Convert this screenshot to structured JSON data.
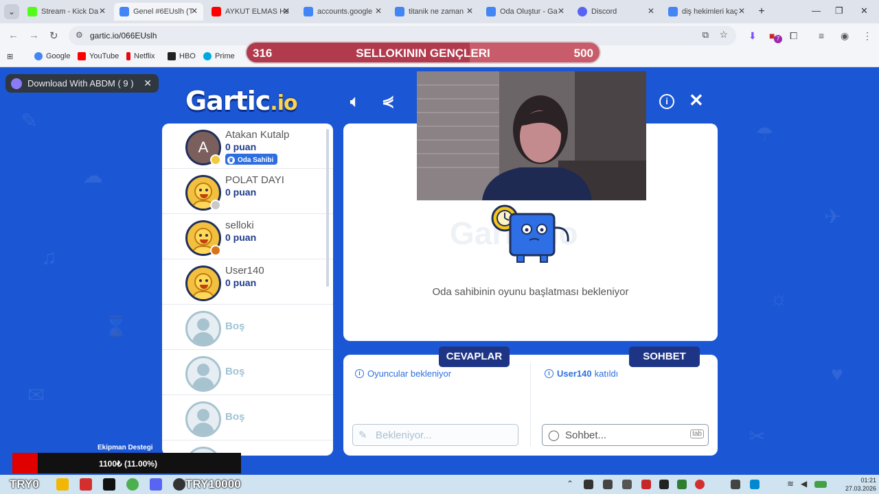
{
  "browser": {
    "tabs": [
      {
        "title": "Stream - Kick Da",
        "color": "#53fc18"
      },
      {
        "title": "Genel #6EUslh (T",
        "color": "#4285f4"
      },
      {
        "title": "AYKUT ELMAS Ha",
        "color": "#ff0000"
      },
      {
        "title": "accounts.google",
        "color": "#4285f4"
      },
      {
        "title": "titanik ne zaman",
        "color": "#4285f4"
      },
      {
        "title": "Oda Oluştur - Ga",
        "color": "#4285f4"
      },
      {
        "title": "Discord",
        "color": "#5865f2"
      },
      {
        "title": "diş hekimleri kaç",
        "color": "#4285f4"
      }
    ],
    "url": "gartic.io/066EUslh",
    "bookmarks": [
      {
        "label": "Google",
        "color": "#4285f4"
      },
      {
        "label": "YouTube",
        "color": "#ff0000"
      },
      {
        "label": "Netflix",
        "color": "#e50914"
      },
      {
        "label": "HBO",
        "color": "#222222"
      },
      {
        "label": "Prime",
        "color": "#00a8e1"
      }
    ],
    "extension_badge": "7"
  },
  "download_popup": {
    "label": "Download With ABDM ( 9 )"
  },
  "scorebar": {
    "left_value": "316",
    "title": "SELLOKININ GENÇLERI",
    "right_value": "500",
    "progress": 0.632
  },
  "logo": {
    "main": "Gartic",
    "suffix": ".io"
  },
  "players": [
    {
      "name": "Atakan Kutalp",
      "score": "0 puan",
      "badge": "Oda Sahibi",
      "avatar": "A",
      "dot": "#f2c93c"
    },
    {
      "name": "POLAT DAYI",
      "score": "0 puan",
      "dot": "#c9c9c9"
    },
    {
      "name": "selloki",
      "score": "0 puan",
      "dot": "#d9731a"
    },
    {
      "name": "User140",
      "score": "0 puan"
    },
    {
      "empty_label": "Boş"
    },
    {
      "empty_label": "Boş"
    },
    {
      "empty_label": "Boş"
    }
  ],
  "stage": {
    "watermark": "Gartic.io",
    "waiting_text": "Oda sahibinin oyunu başlatması bekleniyor"
  },
  "answers": {
    "title": "CEVAPLAR",
    "info": "Oyuncular bekleniyor",
    "placeholder": "Bekleniyor..."
  },
  "chat": {
    "title": "SOHBET",
    "info_user": "User140",
    "info_text": "katıldı",
    "placeholder": "Sohbet...",
    "tab_key": "tab"
  },
  "overlay": {
    "label": "Ekipman Destegi",
    "value": "1100₺ (11.00%)"
  },
  "taskbar": {
    "left_text": "TRY0",
    "center_text": "TRY10000",
    "time": "01:21",
    "date": "27.03.2026"
  }
}
